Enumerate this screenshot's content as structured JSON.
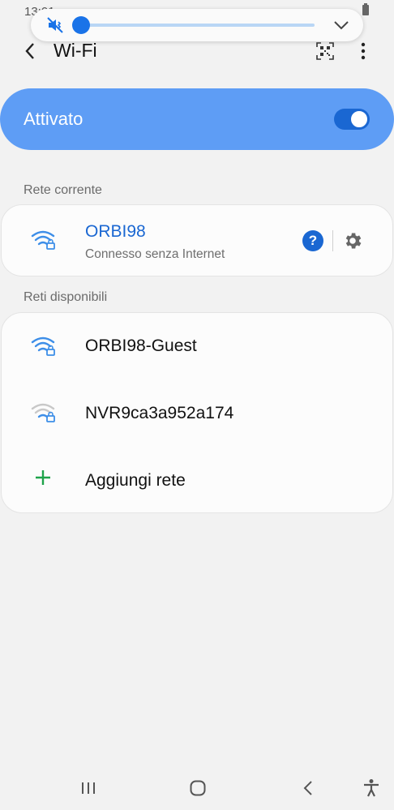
{
  "status_bar": {
    "time": "13:01"
  },
  "volume": {
    "level": 0.0
  },
  "header": {
    "title": "Wi-Fi"
  },
  "toggle": {
    "label": "Attivato",
    "state": "on"
  },
  "sections": {
    "current": "Rete corrente",
    "available": "Reti disponibili"
  },
  "current_network": {
    "name": "ORBI98",
    "status": "Connesso senza Internet",
    "help_glyph": "?"
  },
  "available_networks": [
    {
      "name": "ORBI98-Guest",
      "signal": "strong"
    },
    {
      "name": "NVR9ca3a952a174",
      "signal": "weak"
    }
  ],
  "add_network": {
    "label": "Aggiungi rete"
  },
  "colors": {
    "accent": "#1a67d2",
    "toggle_bg": "#5e9df5",
    "wifi_strong": "#3d8ee8",
    "wifi_weak": "#a9a9a9",
    "add_plus": "#1ea34a"
  }
}
